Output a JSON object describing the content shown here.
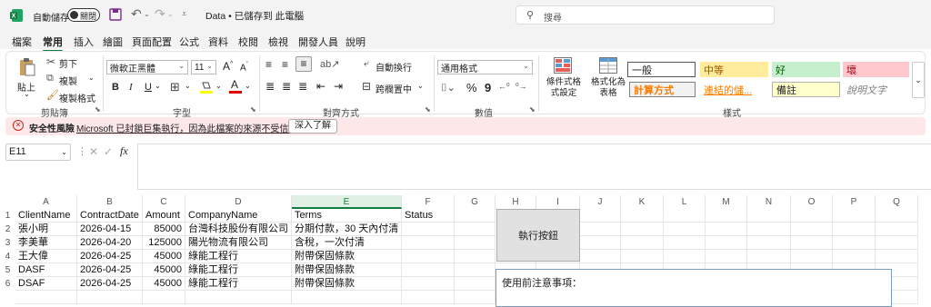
{
  "titlebar": {
    "autosave_label": "自動儲存",
    "autosave_state": "關閉",
    "doc_title": "Data • 已儲存到 此電腦",
    "search_placeholder": "搜尋"
  },
  "ribbon_tabs": [
    "檔案",
    "常用",
    "插入",
    "繪圖",
    "頁面配置",
    "公式",
    "資料",
    "校閱",
    "檢視",
    "開發人員",
    "說明"
  ],
  "clipboard": {
    "paste": "貼上",
    "cut": "剪下",
    "copy": "複製",
    "format_painter": "複製格式",
    "group_label": "剪貼簿"
  },
  "font": {
    "name": "微軟正黑體",
    "size": "11",
    "bold": "B",
    "italic": "I",
    "underline": "U",
    "grow": "A",
    "shrink": "A",
    "color_letter": "A",
    "group_label": "字型"
  },
  "alignment": {
    "wrap_text": "自動換行",
    "merge_center": "跨欄置中",
    "group_label": "對齊方式"
  },
  "number": {
    "format": "通用格式",
    "percent": "%",
    "comma": "9",
    "group_label": "數值"
  },
  "styles": {
    "conditional": "條件式格式設定",
    "format_table": "格式化為表格",
    "cells": [
      "一般",
      "中等",
      "好",
      "壞",
      "計算方式",
      "連結的儲...",
      "備註",
      "說明文字"
    ],
    "group_label": "樣式"
  },
  "security_bar": {
    "label": "安全性風險",
    "message": "Microsoft 已封鎖巨集執行，因為此檔案的來源不受信任。",
    "button": "深入了解"
  },
  "formula_bar": {
    "name_box": "E11",
    "fx": "fx",
    "value": ""
  },
  "sheet": {
    "columns": [
      "A",
      "B",
      "C",
      "D",
      "E",
      "F",
      "G",
      "H",
      "I",
      "J",
      "K",
      "L",
      "M",
      "N",
      "O",
      "P",
      "Q"
    ],
    "row_numbers": [
      "1",
      "2",
      "3",
      "4",
      "5",
      "6"
    ],
    "headers": [
      "ClientName",
      "ContractDate",
      "Amount",
      "CompanyName",
      "Terms",
      "Status"
    ],
    "rows": [
      [
        "張小明",
        "2026-04-15",
        "85000",
        "台灣科技股份有限公司",
        "分期付款，30 天內付清",
        ""
      ],
      [
        "李美華",
        "2026-04-20",
        "125000",
        "陽光物流有限公司",
        "含稅，一次付清",
        ""
      ],
      [
        "王大偉",
        "2026-04-25",
        "45000",
        "綠能工程行",
        "附帶保固條款",
        ""
      ],
      [
        "DASF",
        "2026-04-25",
        "45000",
        "綠能工程行",
        "附帶保固條款",
        ""
      ],
      [
        "DSAF",
        "2026-04-25",
        "45000",
        "綠能工程行",
        "附帶保固條款",
        ""
      ]
    ],
    "run_button": "執行按鈕",
    "notes_title": "使用前注意事項："
  }
}
